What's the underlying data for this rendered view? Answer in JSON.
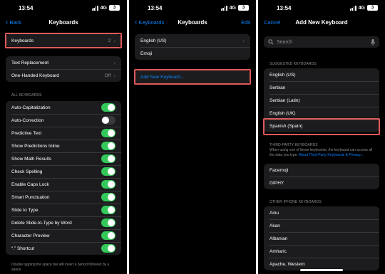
{
  "colors": {
    "accent": "#0a84ff",
    "toggle_on": "#34c759",
    "highlight": "#e05a5a"
  },
  "status": {
    "time": "13:54",
    "network": "4G",
    "battery": "3"
  },
  "screen1": {
    "back": "Back",
    "title": "Keyboards",
    "keyboards_row": {
      "label": "Keyboards",
      "value": "2"
    },
    "text_replacement": "Text Replacement",
    "one_handed": {
      "label": "One-Handed Keyboard",
      "value": "Off"
    },
    "section_header": "ALL KEYBOARDS",
    "toggles": [
      {
        "label": "Auto-Capitalization",
        "on": true
      },
      {
        "label": "Auto-Correction",
        "on": false
      },
      {
        "label": "Predictive Text",
        "on": true
      },
      {
        "label": "Show Predictions Inline",
        "on": true
      },
      {
        "label": "Show Math Results",
        "on": true
      },
      {
        "label": "Check Spelling",
        "on": true
      },
      {
        "label": "Enable Caps Lock",
        "on": true
      },
      {
        "label": "Smart Punctuation",
        "on": true
      },
      {
        "label": "Slide to Type",
        "on": true
      },
      {
        "label": "Delete Slide-to-Type by Word",
        "on": true
      },
      {
        "label": "Character Preview",
        "on": true
      },
      {
        "label": "“.” Shortcut",
        "on": true
      }
    ],
    "footnote": "Double tapping the space bar will insert a period followed by a space."
  },
  "screen2": {
    "back": "Keyboards",
    "title": "Keyboards",
    "edit": "Edit",
    "keyboards": [
      "English (US)",
      "Emoji"
    ],
    "add_new": "Add New Keyboard..."
  },
  "screen3": {
    "cancel": "Cancel",
    "title": "Add New Keyboard",
    "search_placeholder": "Search",
    "suggested_header": "SUGGESTED KEYBOARDS",
    "suggested": [
      "English (US)",
      "Serbian",
      "Serbian (Latin)",
      "English (UK)",
      "Spanish (Spain)"
    ],
    "third_party_header": "THIRD-PARTY KEYBOARDS",
    "third_party_note": "When using one of these keyboards, the keyboard can access all the data you type.",
    "third_party_link": "About Third-Party Keyboards & Privacy...",
    "third_party": [
      "Facemoji",
      "GIPHY"
    ],
    "other_header": "OTHER IPHONE KEYBOARDS",
    "other": [
      "Ainu",
      "Akan",
      "Albanian",
      "Amharic",
      "Apache, Western"
    ]
  }
}
